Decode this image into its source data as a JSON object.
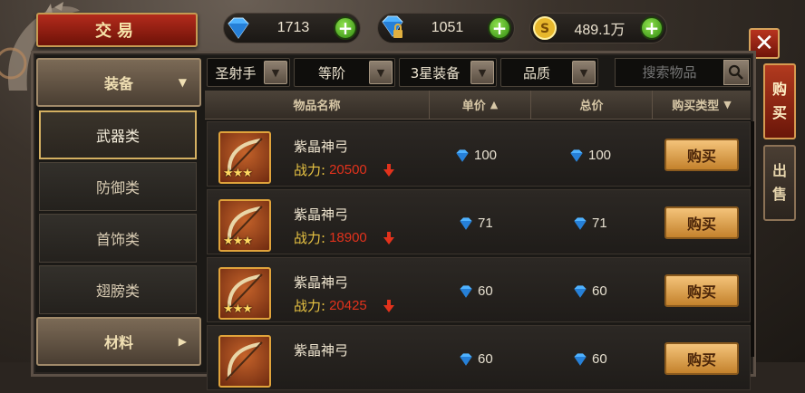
{
  "header": {
    "title": "交易"
  },
  "currency": [
    {
      "icon": "diamond-icon",
      "value": "1713"
    },
    {
      "icon": "locked-diamond-icon",
      "value": "1051"
    },
    {
      "icon": "gold-coin-icon",
      "value": "489.1万"
    }
  ],
  "sidebar": {
    "equipment_label": "装备",
    "sub_items": [
      "武器类",
      "防御类",
      "首饰类",
      "翅膀类"
    ],
    "material_label": "材料"
  },
  "filters": {
    "class": "圣射手",
    "level": "等阶",
    "stars": "3星装备",
    "quality": "品质"
  },
  "search": {
    "placeholder": "搜索物品"
  },
  "table": {
    "headers": [
      "物品名称",
      "单价",
      "总价",
      "购买类型"
    ],
    "power_label": "战力:",
    "buy_label": "购买",
    "rows": [
      {
        "name": "紫晶神弓",
        "power": "20500",
        "unit_price": "100",
        "total_price": "100",
        "stars": "★★★"
      },
      {
        "name": "紫晶神弓",
        "power": "18900",
        "unit_price": "71",
        "total_price": "71",
        "stars": "★★★"
      },
      {
        "name": "紫晶神弓",
        "power": "20425",
        "unit_price": "60",
        "total_price": "60",
        "stars": "★★★"
      },
      {
        "name": "紫晶神弓",
        "power": "",
        "unit_price": "60",
        "total_price": "60",
        "stars": ""
      }
    ]
  },
  "right_tabs": {
    "buy": [
      "购",
      "买"
    ],
    "sell": [
      "出",
      "售"
    ]
  },
  "colors": {
    "accent_red": "#b32b1c",
    "gold": "#e0a33b",
    "power_red": "#e2321c",
    "power_label": "#e9c443"
  }
}
